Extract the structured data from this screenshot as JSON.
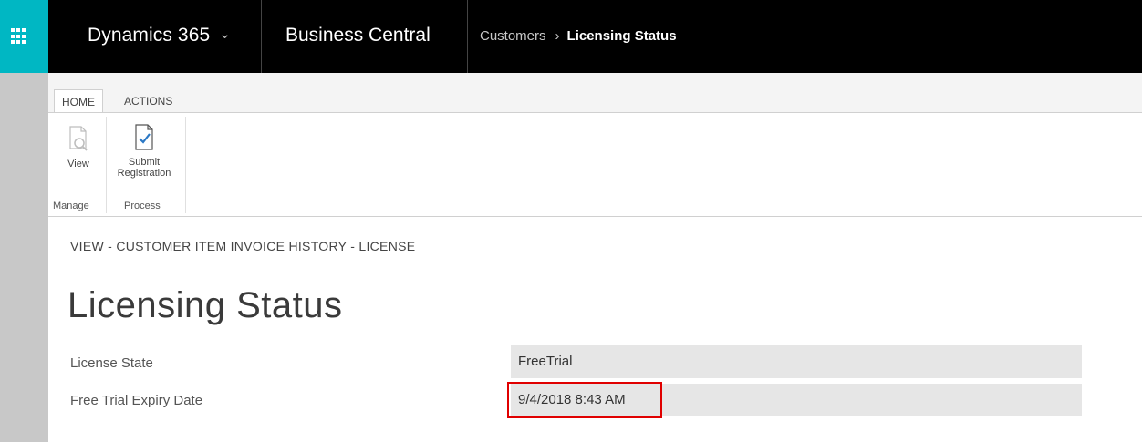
{
  "topbar": {
    "brand": "Dynamics 365",
    "app_name": "Business Central",
    "breadcrumb": [
      "Customers",
      "Licensing Status"
    ],
    "waffle_color": "#00b7c3"
  },
  "ribbon": {
    "tabs": [
      "HOME",
      "ACTIONS"
    ],
    "groups": [
      {
        "label": "Manage",
        "commands": [
          "View"
        ]
      },
      {
        "label": "Process",
        "commands": [
          "Submit Registration"
        ]
      }
    ]
  },
  "page": {
    "caption": "VIEW - CUSTOMER ITEM INVOICE HISTORY - LICENSE",
    "title": "Licensing Status",
    "fields": [
      {
        "label": "License State",
        "value": "FreeTrial"
      },
      {
        "label": "Free Trial Expiry Date",
        "value": "9/4/2018 8:43 AM"
      }
    ],
    "highlight_color": "#e00000"
  },
  "icons": {
    "waffle": "app-launcher-icon",
    "dropdown": "chevron-down-icon",
    "breadcrumb_separator": "chevron-right-icon",
    "view": "document-search-icon",
    "submit": "document-check-icon"
  }
}
